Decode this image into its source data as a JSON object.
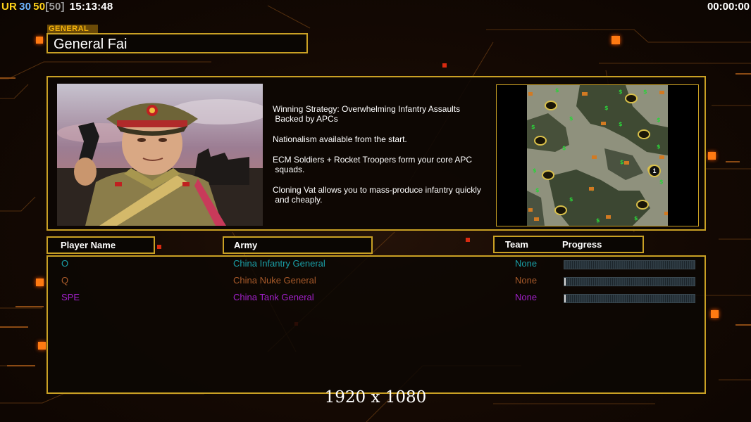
{
  "hud": {
    "ur": "UR",
    "fps_a": "30",
    "fps_b": "50",
    "fps_cap": "[50]",
    "clock": "15:13:48",
    "game_timer": "00:00:00"
  },
  "general": {
    "section_label": "GENERAL",
    "name": "General Fai"
  },
  "description": [
    "Winning Strategy: Overwhelming Infantry Assaults\n Backed by APCs",
    "Nationalism available from the start.",
    "ECM Soldiers + Rocket Troopers form your core APC\n squads.",
    "Cloning Vat allows you to mass-produce infantry quickly\n and cheaply."
  ],
  "map": {
    "start_marker": "1"
  },
  "headers": {
    "player_name": "Player Name",
    "army": "Army",
    "team": "Team",
    "progress": "Progress"
  },
  "players": [
    {
      "name": "O",
      "army": "China Infantry General",
      "team": "None",
      "progress": 0.0,
      "color": "#1aa0a8"
    },
    {
      "name": "Q",
      "army": "China Nuke General",
      "team": "None",
      "progress": 0.01,
      "color": "#a85a2a"
    },
    {
      "name": "SPE",
      "army": "China Tank General",
      "team": "None",
      "progress": 0.01,
      "color": "#a020c8"
    }
  ],
  "footer": {
    "resolution": "1920 x 1080"
  },
  "colors": {
    "frame": "#c9a024",
    "accent_orange": "#ff7a12"
  }
}
